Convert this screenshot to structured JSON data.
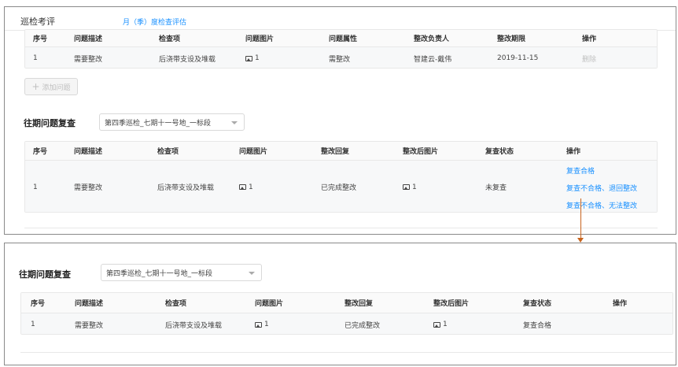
{
  "top": {
    "title": "巡检考评",
    "link": "月（季）度检查评估",
    "issues_table": {
      "headers": [
        "序号",
        "问题描述",
        "检查项",
        "问题图片",
        "问题属性",
        "整改负责人",
        "整改期限",
        "操作"
      ],
      "row": {
        "index": "1",
        "desc": "需要整改",
        "item": "后浇带支设及堆载",
        "pic_count": "1",
        "attr": "需整改",
        "owner": "智建云-戴伟",
        "deadline": "2019-11-15",
        "action": "删除"
      }
    },
    "add_button": "添加问题",
    "review": {
      "title": "往期问题复查",
      "select_value": "第四季巡检_七期十一号地_一标段",
      "headers": [
        "序号",
        "问题描述",
        "检查项",
        "问题图片",
        "整改回复",
        "整改后图片",
        "复查状态",
        "操作"
      ],
      "row": {
        "index": "1",
        "desc": "需要整改",
        "item": "后浇带支设及堆载",
        "pic_count": "1",
        "reply": "已完成整改",
        "after_pic_count": "1",
        "status": "未复查",
        "actions": [
          "复查合格",
          "复查不合格、退回整改",
          "复查不合格、无法整改"
        ]
      }
    }
  },
  "bottom": {
    "review": {
      "title": "往期问题复查",
      "select_value": "第四季巡检_七期十一号地_一标段",
      "headers": [
        "序号",
        "问题描述",
        "检查项",
        "问题图片",
        "整改回复",
        "整改后图片",
        "复查状态",
        "操作"
      ],
      "row": {
        "index": "1",
        "desc": "需要整改",
        "item": "后浇带支设及堆载",
        "pic_count": "1",
        "reply": "已完成整改",
        "after_pic_count": "1",
        "status": "复查合格"
      }
    }
  },
  "colors": {
    "link": "#1890ff",
    "arrow": "#c8641e",
    "disabled": "#c0c0c0"
  }
}
